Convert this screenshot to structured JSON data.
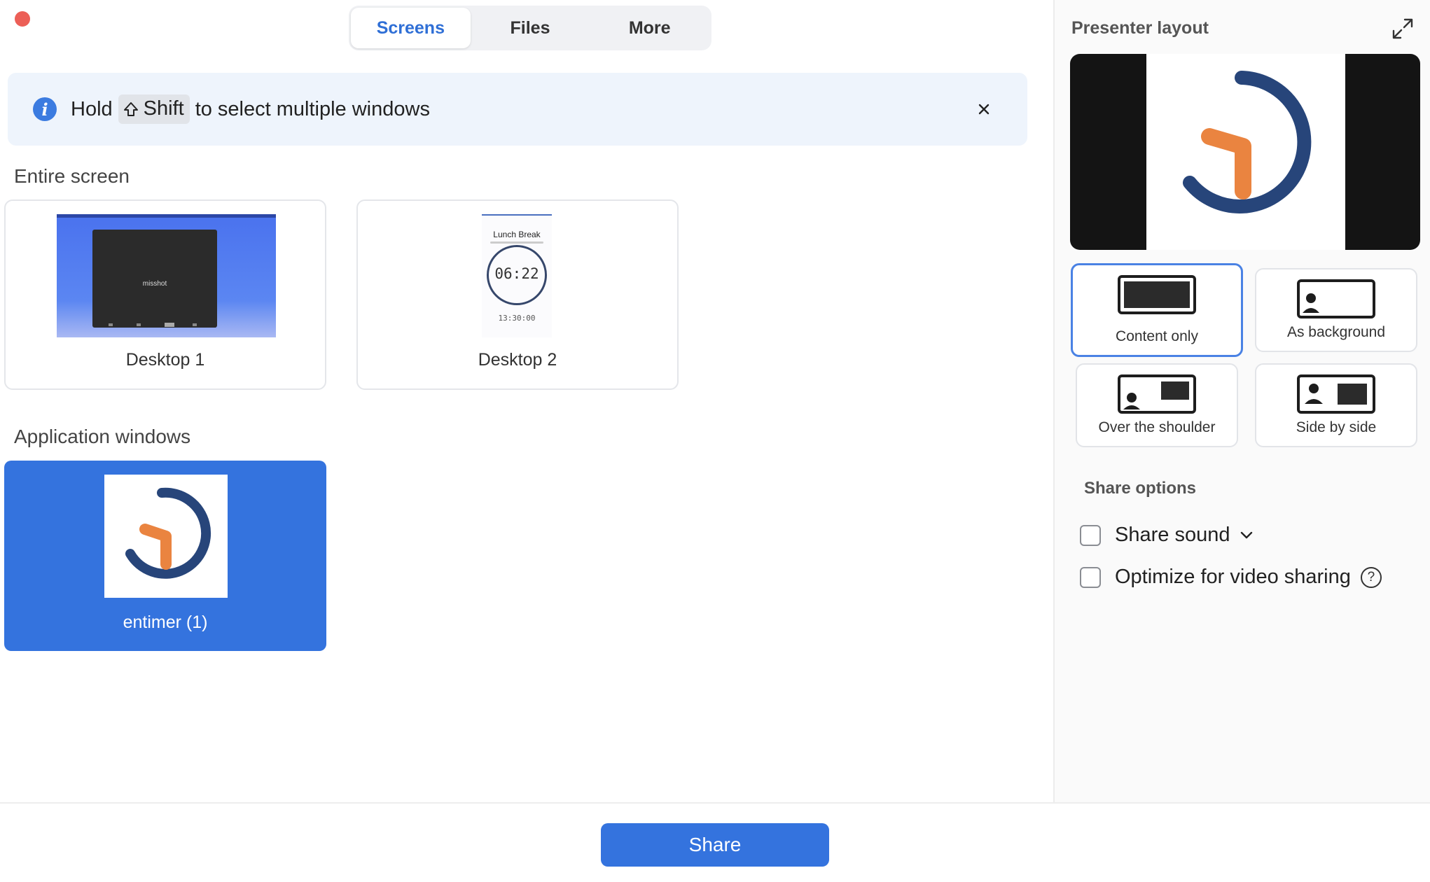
{
  "tabs": [
    {
      "label": "Screens",
      "active": true
    },
    {
      "label": "Files",
      "active": false
    },
    {
      "label": "More",
      "active": false
    }
  ],
  "banner": {
    "hold": "Hold",
    "key": "Shift",
    "rest": "to select multiple windows",
    "icon": "info-icon"
  },
  "sections": {
    "entire_screen": "Entire screen",
    "application_windows": "Application windows"
  },
  "screens": [
    {
      "label": "Desktop 1",
      "window_title": "misshot"
    },
    {
      "label": "Desktop 2",
      "timer_title": "Lunch Break",
      "timer_value": "06:22",
      "alarm_time": "13:30:00"
    }
  ],
  "apps": [
    {
      "label": "entimer (1)",
      "selected": true
    }
  ],
  "share_button": "Share",
  "right_panel": {
    "title": "Presenter layout",
    "layouts": [
      {
        "label": "Content only",
        "selected": true
      },
      {
        "label": "As background",
        "selected": false
      },
      {
        "label": "Over the shoulder",
        "selected": false
      },
      {
        "label": "Side by side",
        "selected": false
      }
    ],
    "share_options_title": "Share options",
    "options": [
      {
        "label": "Share sound",
        "checked": false
      },
      {
        "label": "Optimize for video sharing",
        "checked": false
      }
    ]
  },
  "colors": {
    "accent": "#3473de",
    "logo_navy": "#27457a",
    "logo_orange": "#ea8440",
    "close": "#ec5f57"
  }
}
